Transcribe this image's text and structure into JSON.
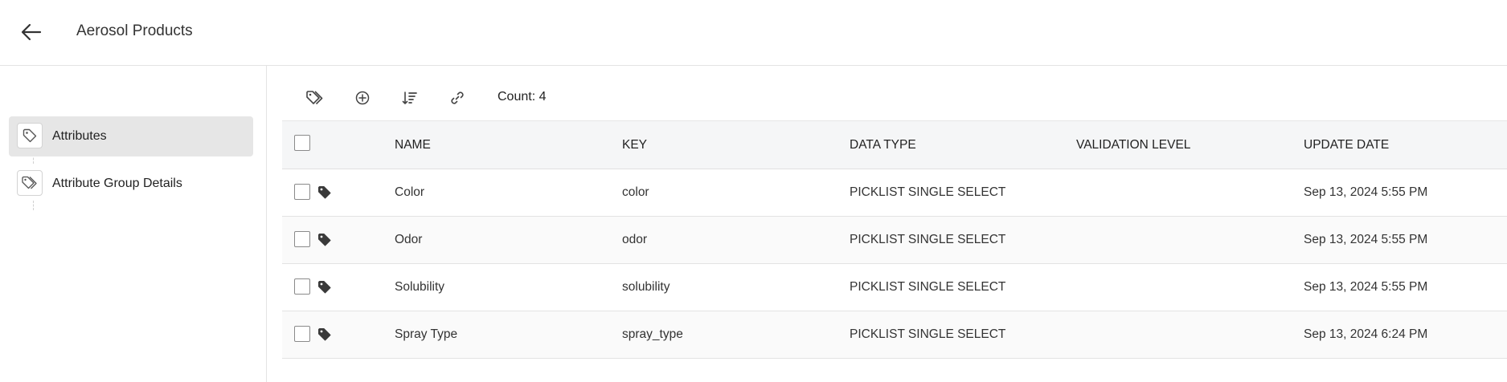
{
  "header": {
    "title": "Aerosol Products",
    "back_icon": "arrow-left-icon"
  },
  "sidebar": {
    "items": [
      {
        "label": "Attributes",
        "icon": "tag-outline-icon",
        "active": true
      },
      {
        "label": "Attribute Group Details",
        "icon": "tags-outline-icon",
        "active": false
      }
    ]
  },
  "toolbar": {
    "buttons": [
      "tags-icon",
      "add-circle-icon",
      "sort-icon",
      "link-icon"
    ],
    "count_text": "Count: 4"
  },
  "table": {
    "columns": [
      "NAME",
      "KEY",
      "DATA TYPE",
      "VALIDATION LEVEL",
      "UPDATE DATE"
    ],
    "rows": [
      {
        "name": "Color",
        "key": "color",
        "data_type": "PICKLIST SINGLE SELECT",
        "validation_level": "",
        "update_date": "Sep 13, 2024 5:55 PM"
      },
      {
        "name": "Odor",
        "key": "odor",
        "data_type": "PICKLIST SINGLE SELECT",
        "validation_level": "",
        "update_date": "Sep 13, 2024 5:55 PM"
      },
      {
        "name": "Solubility",
        "key": "solubility",
        "data_type": "PICKLIST SINGLE SELECT",
        "validation_level": "",
        "update_date": "Sep 13, 2024 5:55 PM"
      },
      {
        "name": "Spray Type",
        "key": "spray_type",
        "data_type": "PICKLIST SINGLE SELECT",
        "validation_level": "",
        "update_date": "Sep 13, 2024 6:24 PM"
      }
    ]
  },
  "colors": {
    "active_item_bg": "#e6e6e6",
    "header_bg": "#f5f6f7",
    "icon": "#444444"
  }
}
